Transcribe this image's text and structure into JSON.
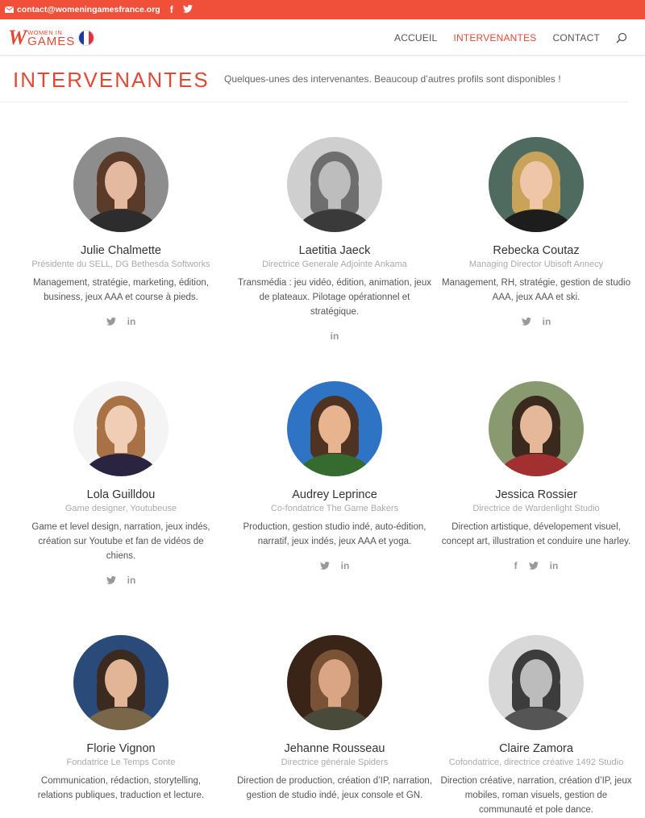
{
  "topbar": {
    "email": "contact@womeningamesfrance.org",
    "facebook_glyph": "f",
    "twitter_icon": "twitter-icon",
    "color": "#f0503a"
  },
  "header": {
    "logo_line1": "WOMEN IN",
    "logo_line2": "GAMES",
    "logo_w": "W",
    "nav": [
      {
        "label": "ACCUEIL"
      },
      {
        "label": "INTERVENANTES"
      },
      {
        "label": "CONTACT"
      }
    ],
    "active_nav": "INTERVENANTES"
  },
  "page": {
    "title": "INTERVENANTES",
    "subtitle": "Quelques-unes des intervenantes. Beaucoup d’autres profils sont disponibles !",
    "accent": "#e04a35"
  },
  "speakers": [
    {
      "name": "Julie Chalmette",
      "role": "Présidente du SELL, DG Bethesda Softworks",
      "bio": "Management, stratégie, marketing, édition, business, jeux AAA et course à pieds.",
      "socials": [
        "twitter",
        "linkedin"
      ]
    },
    {
      "name": "Laetitia Jaeck",
      "role": "Directrice Generale Adjointe Ankama",
      "bio": "Transmédia : jeu vidéo, édition, animation, jeux de plateaux. Pilotage opérationnel et stratégique.",
      "socials": [
        "linkedin"
      ]
    },
    {
      "name": "Rebecka Coutaz",
      "role": "Managing Director Ubisoft Annecy",
      "bio": "Management, RH, stratégie, gestion de studio AAA, jeux AAA et ski.",
      "socials": [
        "twitter",
        "linkedin"
      ]
    },
    {
      "name": "Lola Guilldou",
      "role": "Game designer, Youtubeuse",
      "bio": "Game et level design, narration,  jeux indés, création sur Youtube et fan de vidéos de chiens.",
      "socials": [
        "twitter",
        "linkedin"
      ]
    },
    {
      "name": "Audrey Leprince",
      "role": "Co-fondatrice The Game Bakers",
      "bio": "Production, gestion studio indé, auto-édition, narratif, jeux indés, jeux AAA et yoga.",
      "socials": [
        "twitter",
        "linkedin"
      ]
    },
    {
      "name": "Jessica Rossier",
      "role": "Directrice de Wardenlight Studio",
      "bio": "Direction artistique, dévelopement visuel, concept art, illustration et conduire une harley.",
      "socials": [
        "facebook",
        "twitter",
        "linkedin"
      ]
    },
    {
      "name": "Florie Vignon",
      "role": "Fondatrice Le Temps Conte",
      "bio": "Communication, rédaction, storytelling, relations publiques, traduction et lecture.",
      "socials": []
    },
    {
      "name": "Jehanne Rousseau",
      "role": "Directrice générale Spiders",
      "bio": "Direction de production, création d’IP, narration, gestion de studio indé, jeux console et GN.",
      "socials": []
    },
    {
      "name": "Claire Zamora",
      "role": "Cofondatrice, directrice créative 1492 Studio",
      "bio": "Direction créative, narration, création d’IP, jeux mobiles, roman visuels, gestion de communauté et pole dance.",
      "socials": []
    }
  ],
  "social_glyphs": {
    "facebook": "f",
    "linkedin": "in"
  }
}
